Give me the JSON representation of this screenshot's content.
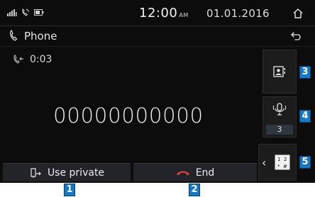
{
  "status_bar": {
    "time": "12:00",
    "ampm": "AM",
    "date": "01.01.2016",
    "icons": [
      "signal-strength-icon",
      "phone-connected-icon",
      "battery-icon"
    ],
    "home_icon": "home-icon"
  },
  "title_bar": {
    "icon": "phone-handset-icon",
    "title": "Phone",
    "back_icon": "back-icon"
  },
  "call": {
    "status_icon": "outgoing-call-icon",
    "duration": "0:03",
    "number": "00000000000"
  },
  "side_buttons": {
    "contacts_icon": "contacts-icon",
    "mute_icon": "microphone-mute-icon",
    "mute_level": "3",
    "keypad_icon": "keypad-icon",
    "keypad_chevron": "‹"
  },
  "bottom_buttons": {
    "private_label": "Use private",
    "private_icon": "use-private-icon",
    "end_label": "End",
    "end_icon": "end-call-icon"
  },
  "callouts": [
    "1",
    "2",
    "3",
    "4",
    "5"
  ],
  "colors": {
    "background": "#0c0c0c",
    "button_bg": "#222429",
    "end_icon": "#d9433a",
    "callout_blue": "#1677c7"
  }
}
